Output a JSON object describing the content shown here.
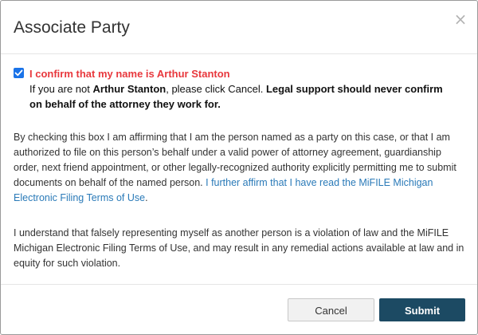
{
  "dialog": {
    "title": "Associate Party",
    "close_symbol": "×"
  },
  "confirmation": {
    "checked": true,
    "label": "I confirm that my name is Arthur Stanton",
    "notice_prefix": "If you are not ",
    "notice_name": "Arthur Stanton",
    "notice_middle": ", please click Cancel. ",
    "notice_warning": "Legal support should never confirm on behalf of the attorney they work for."
  },
  "affirmation": {
    "paragraph1": "By checking this box I am affirming that I am the person named as a party on this case, or that I am authorized to file on this person’s behalf under a valid power of attorney agreement, guardianship order, next friend appointment, or other legally-recognized authority explicitly permitting me to submit documents on behalf of the named person. ",
    "terms_link": "I further affirm that I have read the MiFILE Michigan Electronic Filing Terms of Use",
    "paragraph1_end": ".",
    "paragraph2": "I understand that falsely representing myself as another person is a violation of law and the MiFILE Michigan Electronic Filing Terms of Use, and may result in any remedial actions available at law and in equity for such violation."
  },
  "buttons": {
    "cancel_label": "Cancel",
    "submit_label": "Submit"
  },
  "colors": {
    "accent_red": "#e8383d",
    "link_blue": "#2a7ab8",
    "submit_bg": "#1c4a63",
    "checkbox_blue": "#1a73e8"
  },
  "icons": {
    "close": "close-icon",
    "checkbox": "checkmark-icon"
  }
}
